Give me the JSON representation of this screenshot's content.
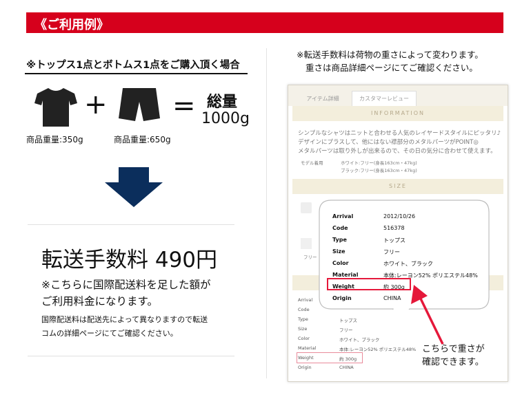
{
  "header": {
    "title": "《ご利用例》"
  },
  "left": {
    "condition": "※トップス1点とボトムス1点をご購入頂く場合",
    "shirt_weight": "商品重量:350g",
    "shorts_weight": "商品重量:650g",
    "total_label": "総量",
    "total_value": "1000g",
    "fee": "転送手数料 490円",
    "note_line1": "※こちらに国際配送料を足した額が",
    "note_line2": "ご利用料金になります。",
    "small_line1": "国際配送料は配送先によって異なりますので転送",
    "small_line2": "コムの詳細ページにてご確認ください。"
  },
  "right": {
    "note_line1": "※転送手数料は荷物の重さによって変わります。",
    "note_line2": "重さは商品詳細ページにてご確認ください。",
    "confirm_line1": "こちらで重さが",
    "confirm_line2": "確認できます。",
    "screenshot": {
      "tab1": "アイテム詳細",
      "tab2": "カスタマーレビュー",
      "information": "INFORMATION",
      "size": "SIZE",
      "desc1": "シンプルなシャツはニットと合わせる人気のレイヤードスタイルにピッタリ♪",
      "desc2": "デザインにプラスして、他にはない襟部分のメタルパーツがPOINT◎",
      "desc3": "メタルパーツは取り外しが出来るので、その日の気分に合わせて使えます。",
      "model_label": "モデル着用",
      "model_white": "ホワイト:フリー(身長163cm・47kg)",
      "model_black": "ブラック:フリー(身長163cm・47kg)",
      "free": "フリー",
      "bottom_rows": [
        {
          "k": "Arrival",
          "v": ""
        },
        {
          "k": "Code",
          "v": ""
        },
        {
          "k": "Type",
          "v": "トップス"
        },
        {
          "k": "Size",
          "v": "フリー"
        },
        {
          "k": "Color",
          "v": "ホワイト、ブラック"
        },
        {
          "k": "Material",
          "v": "本体:レーヨン52% ポリエステル48%"
        },
        {
          "k": "Weight",
          "v": "約 300g"
        },
        {
          "k": "Origin",
          "v": "CHINA"
        }
      ]
    },
    "bubble_rows": [
      {
        "k": "Arrival",
        "v": "2012/10/26"
      },
      {
        "k": "Code",
        "v": "516378"
      },
      {
        "k": "Type",
        "v": "トップス"
      },
      {
        "k": "Size",
        "v": "フリー"
      },
      {
        "k": "Color",
        "v": "ホワイト、ブラック"
      },
      {
        "k": "Material",
        "v": "本体:レーヨン52% ポリエステル48%"
      },
      {
        "k": "Weight",
        "v": "約 300g"
      },
      {
        "k": "Origin",
        "v": "CHINA"
      }
    ]
  },
  "colors": {
    "header_red": "#d6001c",
    "arrow_navy": "#0b2e5c",
    "highlight_red": "#e5183a"
  }
}
